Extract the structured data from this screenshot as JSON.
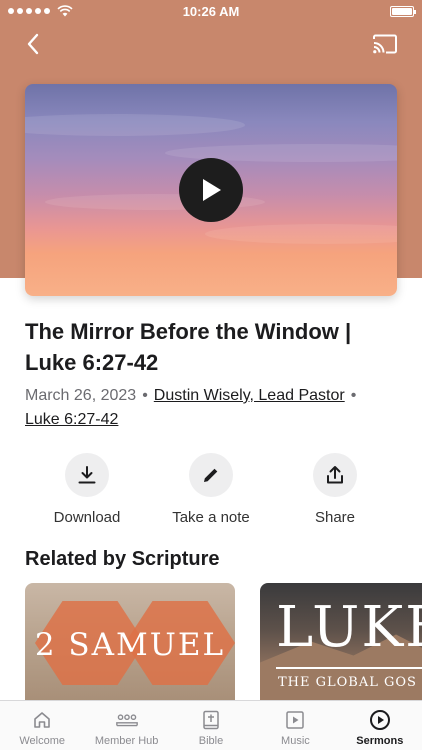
{
  "status_bar": {
    "time": "10:26 AM"
  },
  "nav": {
    "back_icon": "chevron-left-icon",
    "cast_icon": "cast-icon"
  },
  "video": {
    "play_icon": "play-icon"
  },
  "sermon": {
    "title": "The Mirror Before the Window | Luke 6:27-42",
    "date": "March 26, 2023",
    "speaker": "Dustin Wisely, Lead Pastor",
    "scripture": "Luke 6:27-42",
    "separator": "•"
  },
  "actions": [
    {
      "label": "Download",
      "icon": "download-icon"
    },
    {
      "label": "Take a note",
      "icon": "pencil-icon"
    },
    {
      "label": "Share",
      "icon": "share-icon"
    }
  ],
  "related": {
    "heading": "Related by Scripture",
    "cards": [
      {
        "title": "2 SAMUEL"
      },
      {
        "title": "LUKE",
        "subtitle": "THE GLOBAL GOS"
      }
    ]
  },
  "tabs": [
    {
      "label": "Welcome",
      "icon": "home-icon"
    },
    {
      "label": "Member Hub",
      "icon": "people-icon"
    },
    {
      "label": "Bible",
      "icon": "bible-icon"
    },
    {
      "label": "Music",
      "icon": "music-play-icon"
    },
    {
      "label": "Sermons",
      "icon": "sermons-play-icon",
      "active": true
    }
  ],
  "colors": {
    "hero": "#c8876c",
    "accent_orange": "#de7046",
    "text": "#1c1c1e",
    "muted": "#6b6b70"
  }
}
